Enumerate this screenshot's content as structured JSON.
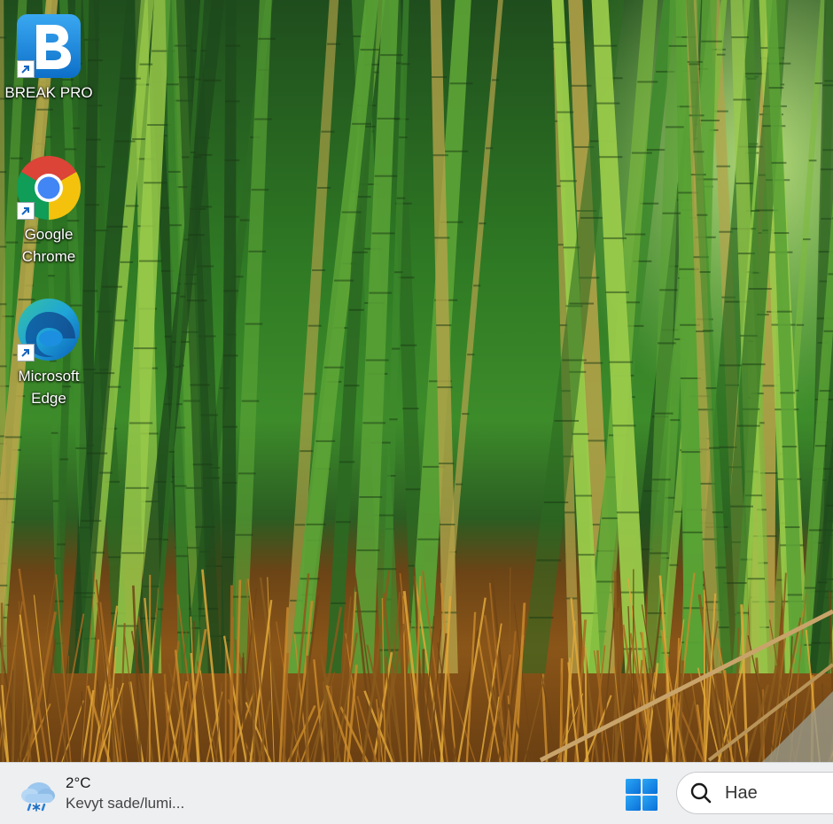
{
  "desktop": {
    "icons": [
      {
        "label": "BREAK PRO",
        "icon": "break-pro-icon"
      },
      {
        "label": "Google Chrome",
        "label_lines": [
          "Google",
          "Chrome"
        ],
        "icon": "chrome-icon"
      },
      {
        "label": "Microsoft Edge",
        "label_lines": [
          "Microsoft",
          "Edge"
        ],
        "icon": "edge-icon"
      }
    ]
  },
  "taskbar": {
    "weather": {
      "temperature": "2°C",
      "description": "Kevyt sade/lumi...",
      "icon": "cloud-sleet-icon"
    },
    "start_icon": "windows-logo-icon",
    "search": {
      "placeholder": "Hae",
      "icon": "search-icon"
    }
  },
  "colors": {
    "taskbar_bg": "#eeeff1",
    "windows_blue": "#0f8ae8",
    "break_pro_blue": "#1a8fe0"
  }
}
